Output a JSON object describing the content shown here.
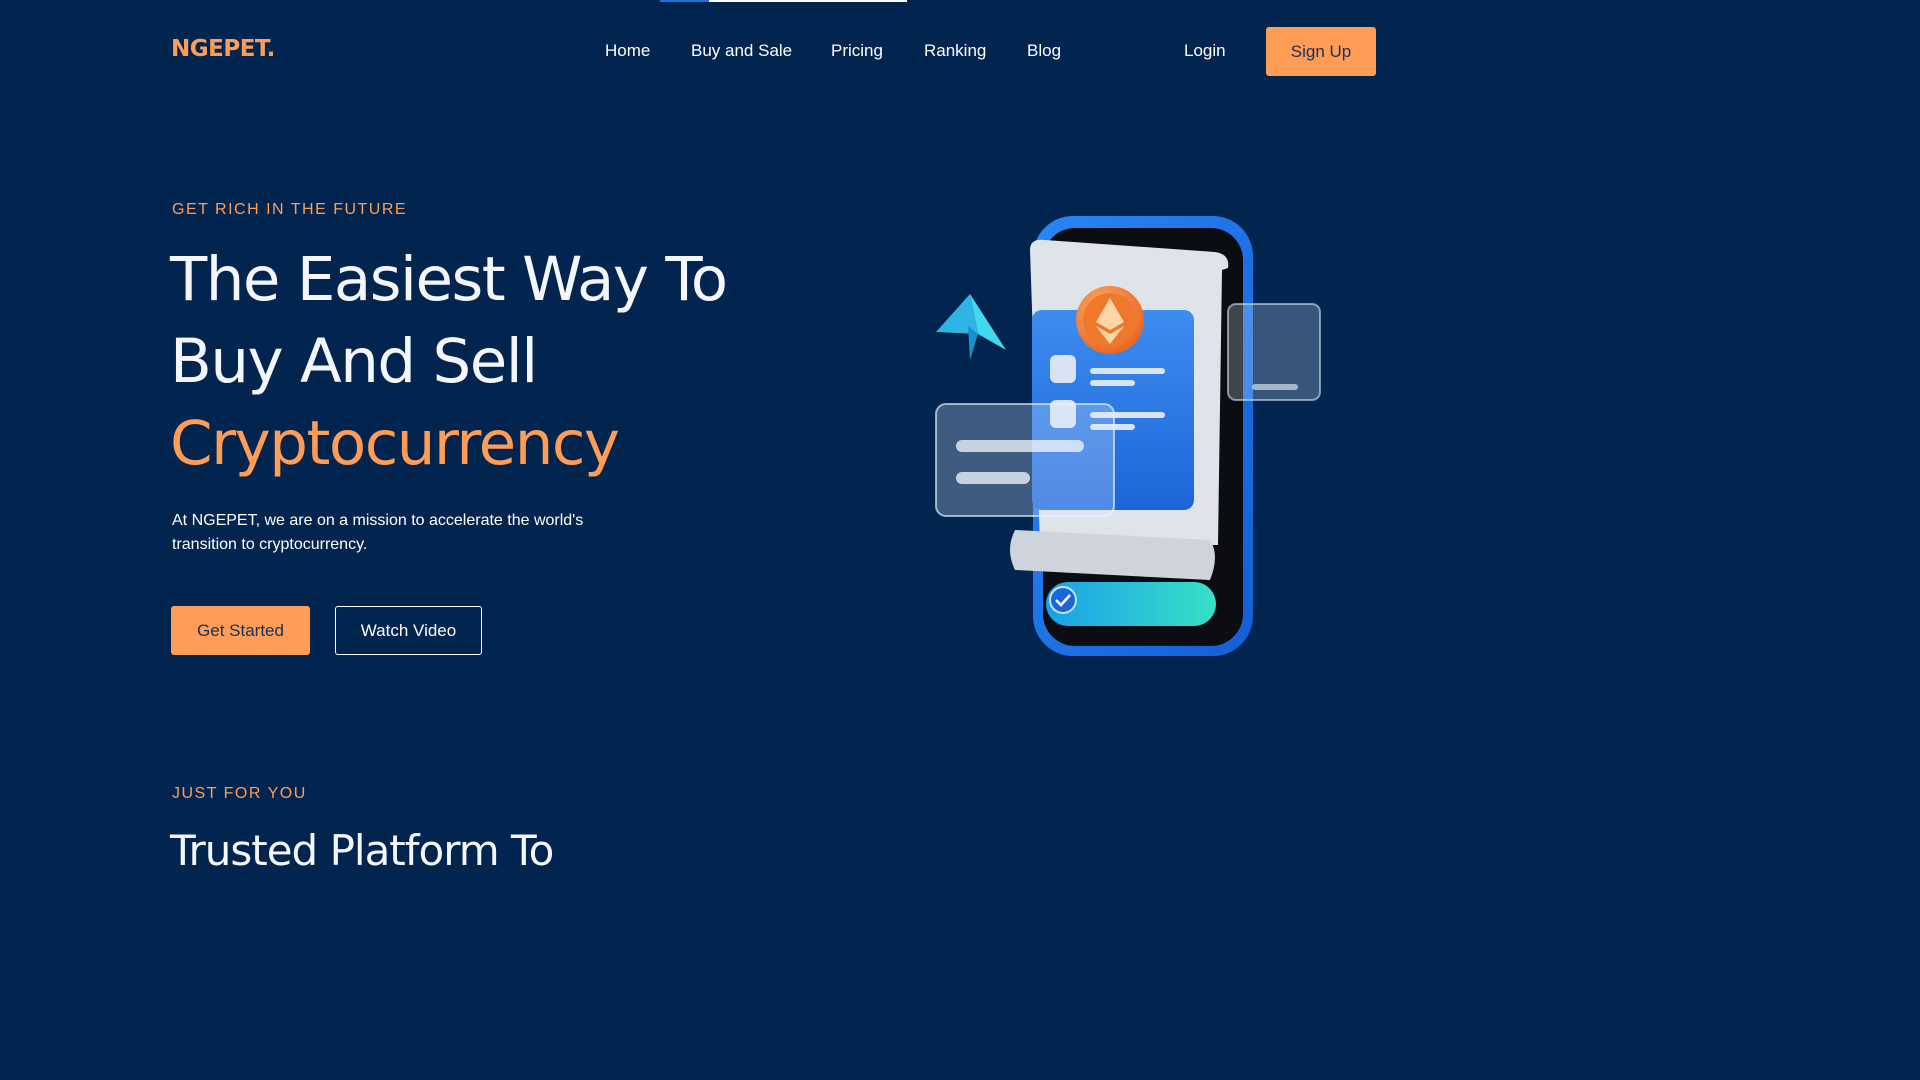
{
  "page_progress": {
    "fraction": 0.2
  },
  "header": {
    "logo": "NGEPET.",
    "nav": [
      "Home",
      "Buy and Sale",
      "Pricing",
      "Ranking",
      "Blog"
    ],
    "login": "Login",
    "signup": "Sign Up"
  },
  "hero": {
    "eyebrow": "GET RICH IN THE FUTURE",
    "title_line1": "The Easiest Way To",
    "title_line2": "Buy And Sell",
    "title_accent": "Cryptocurrency",
    "description": "At NGEPET, we are on a mission to accelerate the world's transition to cryptocurrency.",
    "primary_button": "Get Started",
    "secondary_button": "Watch Video",
    "illustration": [
      "phone-illustration",
      "ethereum-coin-icon",
      "paper-plane-icon",
      "check-icon"
    ]
  },
  "section2": {
    "eyebrow": "JUST FOR YOU",
    "title": "Trusted Platform To"
  },
  "colors": {
    "background": "#02254f",
    "accent": "#ff9d57",
    "text": "#ffffff",
    "phone_blue": "#1f72e6"
  }
}
